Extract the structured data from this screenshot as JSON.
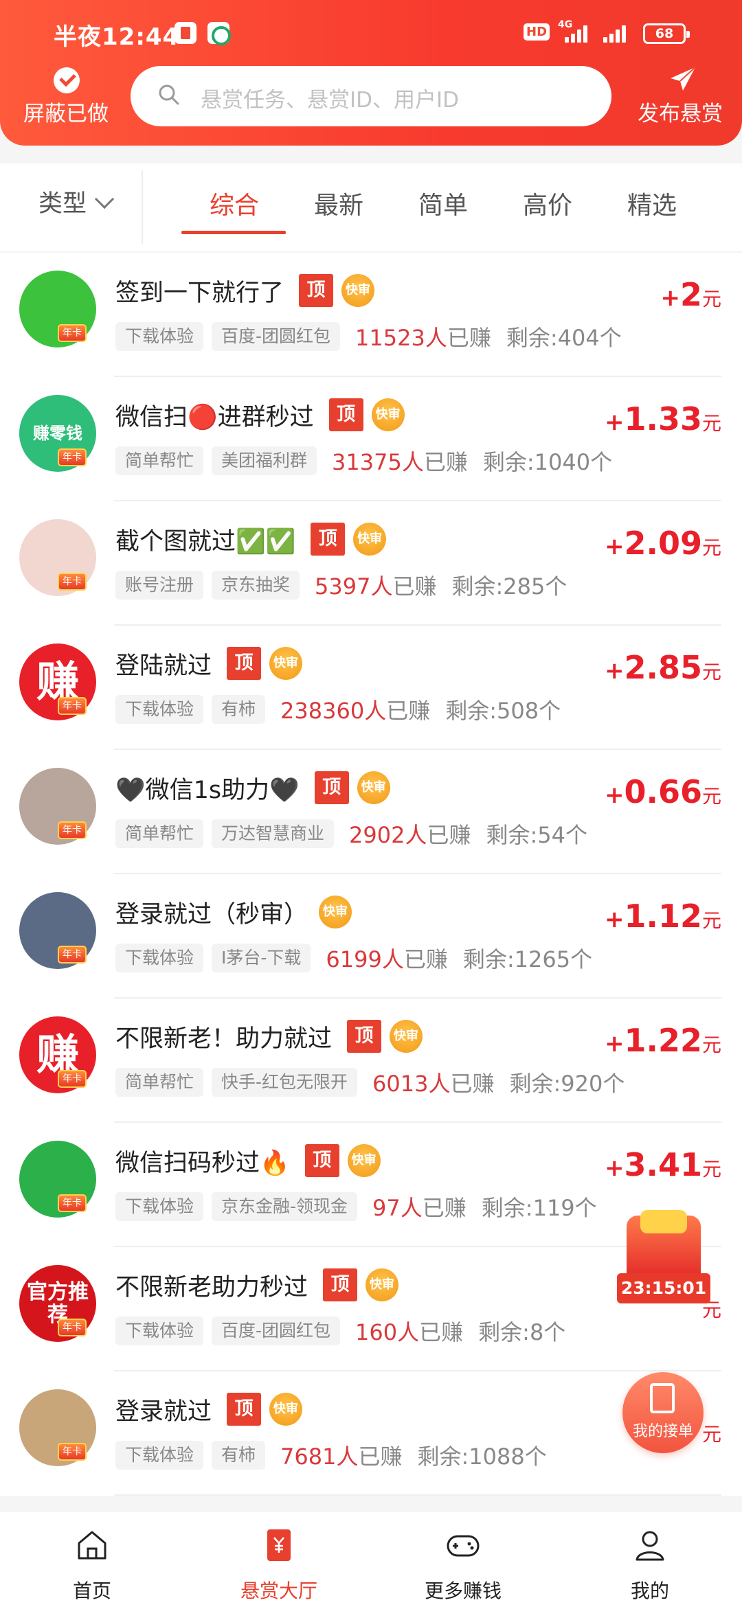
{
  "status_bar": {
    "time": "半夜12:44",
    "hd": "HD",
    "network": "4G",
    "battery": "68"
  },
  "header": {
    "shield_label": "屏蔽已做",
    "search_placeholder": "悬赏任务、悬赏ID、用户ID",
    "publish_label": "发布悬赏"
  },
  "filter": {
    "type_label": "类型",
    "tabs": [
      "综合",
      "最新",
      "简单",
      "高价",
      "精选"
    ],
    "active_tab": "综合"
  },
  "badges": {
    "top": "顶",
    "fast": "快审",
    "year": "年卡"
  },
  "tasks": [
    {
      "title": "签到一下就行了",
      "top": true,
      "cat": "下载体验",
      "sub": "百度-团圆红包",
      "earned": "11523人",
      "earned_suffix": "已赚",
      "remain": "剩余:404个",
      "plus": "+",
      "amount": "2",
      "unit": "元",
      "avatar_text": "",
      "avatar_color": "#3cc23c"
    },
    {
      "title": "微信扫🔴进群秒过",
      "top": true,
      "cat": "简单帮忙",
      "sub": "美团福利群",
      "earned": "31375人",
      "earned_suffix": "已赚",
      "remain": "剩余:1040个",
      "plus": "+",
      "amount": "1.33",
      "unit": "元",
      "avatar_text": "赚零钱",
      "avatar_color": "#2fbd7a"
    },
    {
      "title": "截个图就过✅✅",
      "top": true,
      "cat": "账号注册",
      "sub": "京东抽奖",
      "earned": "5397人",
      "earned_suffix": "已赚",
      "remain": "剩余:285个",
      "plus": "+",
      "amount": "2.09",
      "unit": "元",
      "avatar_text": "",
      "avatar_color": "#f1d7cf"
    },
    {
      "title": "登陆就过",
      "top": true,
      "cat": "下载体验",
      "sub": "有柿",
      "earned": "238360人",
      "earned_suffix": "已赚",
      "remain": "剩余:508个",
      "plus": "+",
      "amount": "2.85",
      "unit": "元",
      "avatar_text": "赚",
      "avatar_color": "#e8202a"
    },
    {
      "title": "🖤微信1s助力🖤",
      "top": true,
      "cat": "简单帮忙",
      "sub": "万达智慧商业",
      "earned": "2902人",
      "earned_suffix": "已赚",
      "remain": "剩余:54个",
      "plus": "+",
      "amount": "0.66",
      "unit": "元",
      "avatar_text": "",
      "avatar_color": "#b8a59c"
    },
    {
      "title": "登录就过（秒审）",
      "top": false,
      "cat": "下载体验",
      "sub": "I茅台-下载",
      "earned": "6199人",
      "earned_suffix": "已赚",
      "remain": "剩余:1265个",
      "plus": "+",
      "amount": "1.12",
      "unit": "元",
      "avatar_text": "",
      "avatar_color": "#5b6b86"
    },
    {
      "title": "不限新老！助力就过",
      "top": true,
      "cat": "简单帮忙",
      "sub": "快手-红包无限开",
      "earned": "6013人",
      "earned_suffix": "已赚",
      "remain": "剩余:920个",
      "plus": "+",
      "amount": "1.22",
      "unit": "元",
      "avatar_text": "赚",
      "avatar_color": "#e8202a"
    },
    {
      "title": "微信扫码秒过🔥",
      "top": true,
      "cat": "下载体验",
      "sub": "京东金融-领现金",
      "earned": "97人",
      "earned_suffix": "已赚",
      "remain": "剩余:119个",
      "plus": "+",
      "amount": "3.41",
      "unit": "元",
      "avatar_text": "",
      "avatar_color": "#2bb04a"
    },
    {
      "title": "不限新老助力秒过",
      "top": true,
      "cat": "下载体验",
      "sub": "百度-团圆红包",
      "earned": "160人",
      "earned_suffix": "已赚",
      "remain": "剩余:8个",
      "plus": "",
      "amount": "",
      "unit": "元",
      "avatar_text": "官方推荐",
      "avatar_color": "#d4161c"
    },
    {
      "title": "登录就过",
      "top": true,
      "cat": "下载体验",
      "sub": "有柿",
      "earned": "7681人",
      "earned_suffix": "已赚",
      "remain": "剩余:1088个",
      "plus": "",
      "amount": "",
      "unit": "元",
      "avatar_text": "",
      "avatar_color": "#c9a57a"
    }
  ],
  "floating": {
    "timer": "23:15:01",
    "my_orders": "我的接单"
  },
  "bottom_nav": [
    {
      "label": "首页",
      "icon": "home-icon"
    },
    {
      "label": "悬赏大厅",
      "icon": "reward-hall-icon",
      "active": true
    },
    {
      "label": "更多赚钱",
      "icon": "gamepad-icon"
    },
    {
      "label": "我的",
      "icon": "profile-icon"
    }
  ]
}
